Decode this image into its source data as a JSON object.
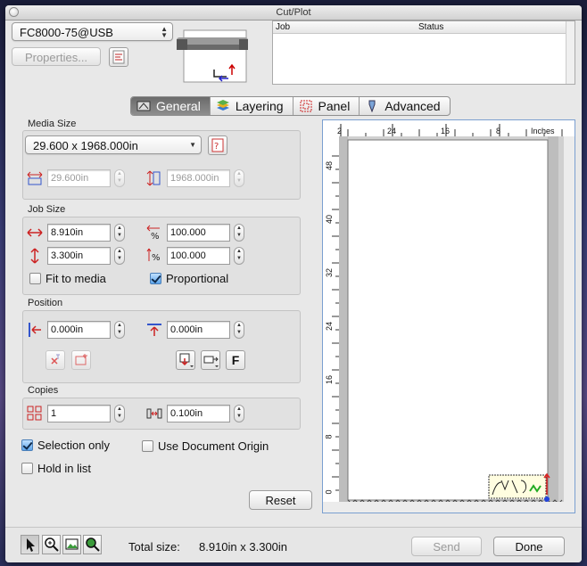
{
  "window": {
    "title": "Cut/Plot"
  },
  "device": {
    "selected": "FC8000-75@USB",
    "properties_label": "Properties..."
  },
  "job_table": {
    "columns": [
      "Job",
      "Status"
    ],
    "rows": []
  },
  "tabs": [
    {
      "label": "General",
      "selected": true,
      "icon": "general-icon"
    },
    {
      "label": "Layering",
      "selected": false,
      "icon": "layering-icon"
    },
    {
      "label": "Panel",
      "selected": false,
      "icon": "panel-icon"
    },
    {
      "label": "Advanced",
      "selected": false,
      "icon": "advanced-icon"
    }
  ],
  "media": {
    "title": "Media Size",
    "selected": "29.600 x 1968.000in",
    "width": "29.600in",
    "length": "1968.000in"
  },
  "job_size": {
    "title": "Job Size",
    "width": "8.910in",
    "height": "3.300in",
    "width_pct": "100.000",
    "height_pct": "100.000",
    "fit_to_media": {
      "label": "Fit to media",
      "checked": false
    },
    "proportional": {
      "label": "Proportional",
      "checked": true
    }
  },
  "position": {
    "title": "Position",
    "x": "0.000in",
    "y": "0.000in",
    "text_button": "F"
  },
  "copies": {
    "title": "Copies",
    "count": "1",
    "spacing": "0.100in"
  },
  "options": {
    "selection_only": {
      "label": "Selection only",
      "checked": true
    },
    "use_document_origin": {
      "label": "Use Document Origin",
      "checked": false
    },
    "hold_in_list": {
      "label": "Hold in list",
      "checked": false
    }
  },
  "reset_label": "Reset",
  "preview": {
    "top_ruler": {
      "ticks": [
        "2",
        "24",
        "16",
        "8"
      ],
      "units": "Inches"
    },
    "left_ruler": {
      "ticks": [
        "48",
        "40",
        "32",
        "24",
        "16",
        "8",
        "0"
      ]
    }
  },
  "footer": {
    "total_label": "Total size:",
    "total_value": "8.910in x 3.300in",
    "send_label": "Send",
    "done_label": "Done"
  }
}
